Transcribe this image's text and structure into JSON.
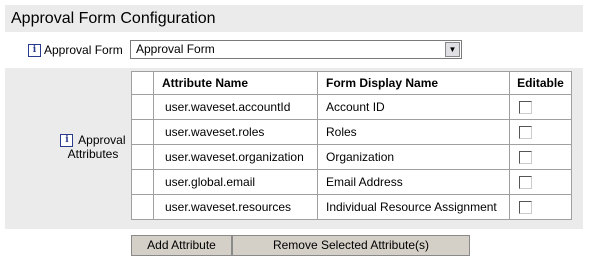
{
  "page": {
    "title": "Approval Form Configuration"
  },
  "form": {
    "label": "Approval Form",
    "selected": "Approval Form"
  },
  "attributes": {
    "label": "Approval Attributes",
    "columns": [
      "Attribute Name",
      "Form Display Name",
      "Editable"
    ],
    "rows": [
      {
        "name": "user.waveset.accountId",
        "display": "Account ID",
        "editable": false
      },
      {
        "name": "user.waveset.roles",
        "display": "Roles",
        "editable": false
      },
      {
        "name": "user.waveset.organization",
        "display": "Organization",
        "editable": false
      },
      {
        "name": "user.global.email",
        "display": "Email Address",
        "editable": false
      },
      {
        "name": "user.waveset.resources",
        "display": "Individual Resource Assignment",
        "editable": false
      }
    ]
  },
  "buttons": {
    "add": "Add Attribute",
    "remove": "Remove Selected Attribute(s)"
  },
  "icons": {
    "info": "i"
  }
}
